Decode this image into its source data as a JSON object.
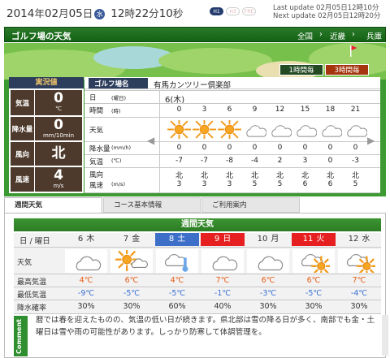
{
  "top": {
    "date_year": "2014",
    "date_nen": "年",
    "date_month": "02",
    "date_gatsu": "月",
    "date_day": "05",
    "date_nichi": "日",
    "weekday": "水",
    "time_h": "12",
    "time_ji": "時",
    "time_m": "22",
    "time_fun": "分",
    "time_s": "10",
    "time_byo": "秒",
    "modes": [
      "H1",
      "H3",
      "FRE"
    ],
    "last_update": "Last update 02月05日12時10分",
    "next_update": "Next update 02月05日12時20分"
  },
  "header": {
    "title": "ゴルフ場の天気",
    "crumbs": [
      "全国",
      "近畿",
      "兵庫"
    ],
    "crumb_sep": "›"
  },
  "course_tabs": [
    "1時間毎",
    "3時間毎"
  ],
  "current": {
    "heading": "実況値",
    "rows": [
      {
        "label": "気温",
        "value": "0",
        "unit": "℃"
      },
      {
        "label": "降水量",
        "value": "0",
        "unit": "mm/10min"
      },
      {
        "label": "風向",
        "value": "北",
        "unit": ""
      },
      {
        "label": "風速",
        "value": "4",
        "unit": "m/s"
      }
    ]
  },
  "forecast": {
    "course_label": "ゴルフ場名",
    "course_name": "有馬カンツリー倶楽部",
    "day_label": "日",
    "day_sub": "(曜日)",
    "day_value": "6(木)",
    "time_label": "時間",
    "time_sub": "(時)",
    "hours": [
      "0",
      "3",
      "6",
      "9",
      "12",
      "15",
      "18",
      "21"
    ],
    "weather_label": "天気",
    "icons": [
      "sun",
      "sun",
      "sun",
      "cloud",
      "cloud",
      "cloud",
      "cloud",
      "cloud"
    ],
    "precip_label": "降水量",
    "precip_sub": "(mm/h)",
    "precip": [
      "0",
      "0",
      "0",
      "0",
      "0",
      "0",
      "0",
      "0"
    ],
    "temp_label": "気温",
    "temp_sub": "(℃)",
    "temp": [
      "-7",
      "-7",
      "-8",
      "-4",
      "2",
      "3",
      "0",
      "-3"
    ],
    "wdir_label": "風向",
    "wspd_label": "風速",
    "wspd_sub": "(m/s)",
    "wind_dir": [
      "北",
      "北",
      "北",
      "北",
      "北",
      "北",
      "北",
      "北"
    ],
    "wind_speed": [
      "3",
      "3",
      "3",
      "5",
      "5",
      "6",
      "6",
      "5"
    ]
  },
  "weekly": {
    "tabs": [
      "週間天気",
      "コース基本情報",
      "ご利用案内"
    ],
    "heading": "週間天気",
    "day_header": "日 / 曜日",
    "weather_label": "天気",
    "max_label": "最高気温",
    "min_label": "最低気温",
    "pop_label": "降水確率",
    "days": [
      {
        "d": "6",
        "w": "木",
        "type": "",
        "icon": "cloud",
        "max": "4℃",
        "min": "-9℃",
        "pop": "30%"
      },
      {
        "d": "7",
        "w": "金",
        "type": "",
        "icon": "sun-cloud",
        "max": "6℃",
        "min": "-5℃",
        "pop": "30%"
      },
      {
        "d": "8",
        "w": "土",
        "type": "sat",
        "icon": "cloud-snow",
        "max": "4℃",
        "min": "-5℃",
        "pop": "60%"
      },
      {
        "d": "9",
        "w": "日",
        "type": "sun",
        "icon": "cloud",
        "max": "7℃",
        "min": "-1℃",
        "pop": "40%"
      },
      {
        "d": "10",
        "w": "月",
        "type": "",
        "icon": "cloud",
        "max": "6℃",
        "min": "-3℃",
        "pop": "30%"
      },
      {
        "d": "11",
        "w": "火",
        "type": "sun",
        "icon": "cloud-sun",
        "max": "6℃",
        "min": "-5℃",
        "pop": "30%"
      },
      {
        "d": "12",
        "w": "水",
        "type": "",
        "icon": "cloud-sun",
        "max": "7℃",
        "min": "-4℃",
        "pop": "30%"
      }
    ],
    "comment_label": "Comment",
    "comment": "暦では春を迎えたものの、気温の低い日が続きます。県北部は雪の降る日が多く、南部でも金・土曜日は雪や雨の可能性があります。しっかり防寒して体調管理を。"
  },
  "colors": {
    "accent_green": "#2b7a2b",
    "high_temp": "#e85c15",
    "low_temp": "#3a6fd4",
    "saturday": "#3d6fc9",
    "sunday": "#e62020"
  }
}
